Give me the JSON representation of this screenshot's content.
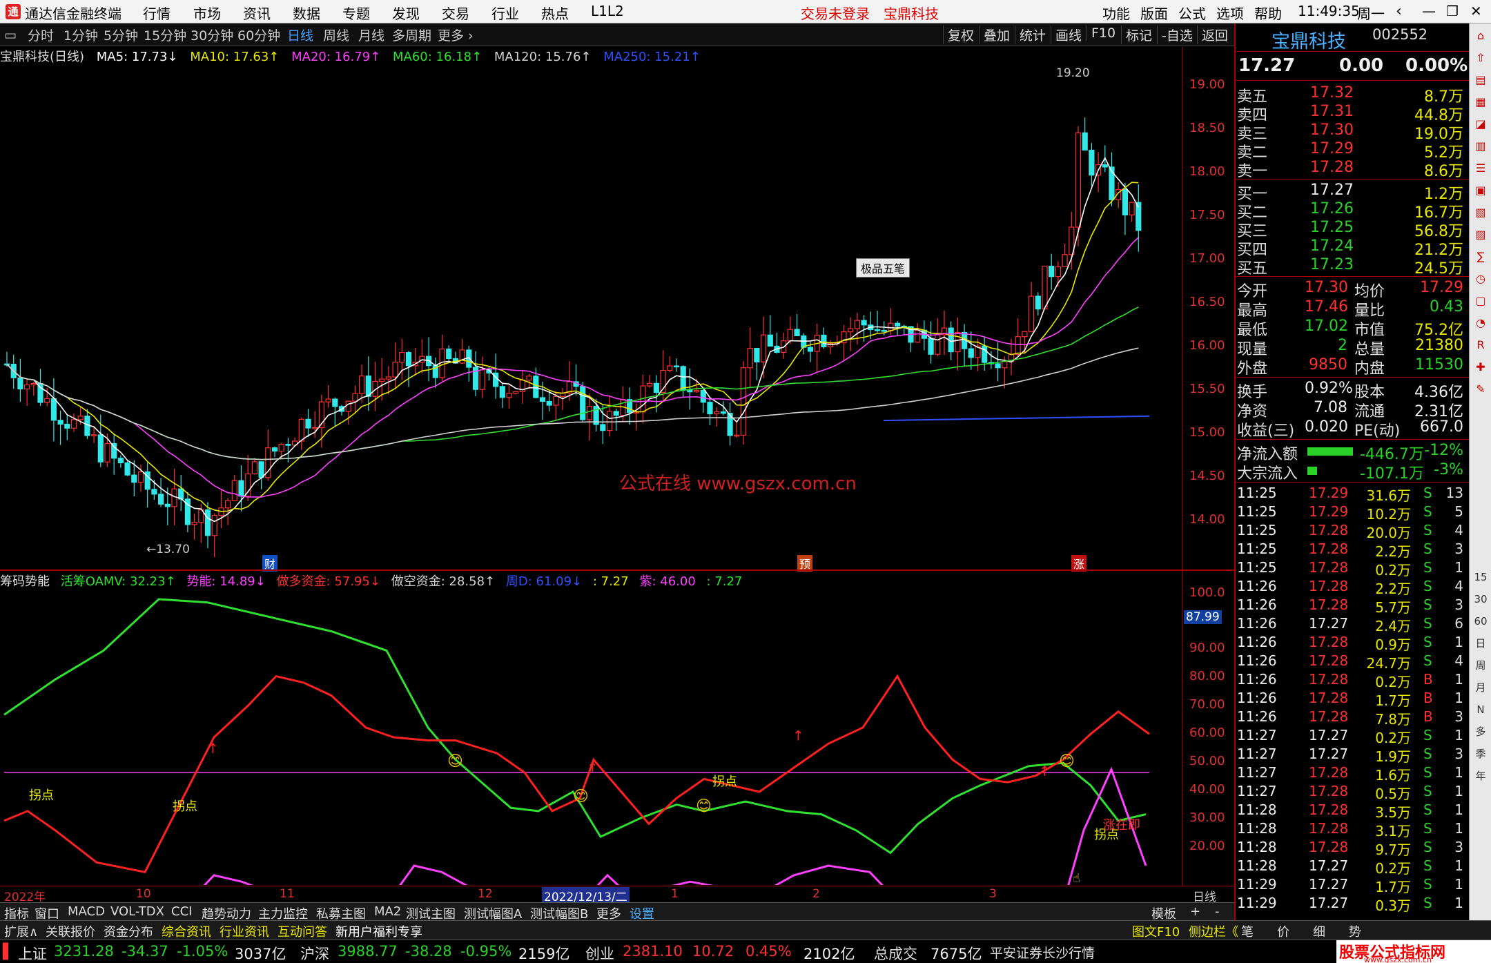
{
  "titlebar": {
    "app": "通达信金融终端",
    "menu": [
      "行情",
      "市场",
      "资讯",
      "数据",
      "专题",
      "发现",
      "交易",
      "行业",
      "热点",
      "L1L2"
    ],
    "trade_status": "交易未登录",
    "stock_name": "宝鼎科技",
    "right_menu": [
      "功能",
      "版面",
      "公式",
      "选项",
      "帮助"
    ],
    "time": "11:49:35",
    "weekday": "周一"
  },
  "periodbar": {
    "items": [
      "分时",
      "1分钟",
      "5分钟",
      "15分钟",
      "30分钟",
      "60分钟",
      "日线",
      "周线",
      "月线",
      "多周期",
      "更多 ›"
    ],
    "active": "日线",
    "right": [
      "复权",
      "叠加",
      "统计",
      "画线",
      "F10",
      "标记",
      "-自选",
      "返回"
    ]
  },
  "ma": {
    "name": "宝鼎科技(日线)",
    "items": [
      {
        "t": "MA5: 17.73↓",
        "c": "#ffffff"
      },
      {
        "t": "MA10: 17.63↑",
        "c": "#e8e800"
      },
      {
        "t": "MA20: 16.79↑",
        "c": "#ff40ff"
      },
      {
        "t": "MA60: 16.18↑",
        "c": "#30e030"
      },
      {
        "t": "MA120: 15.76↑",
        "c": "#d0d0d0"
      },
      {
        "t": "MA250: 15.21↑",
        "c": "#3050ff"
      }
    ]
  },
  "main_axis": {
    "ticks": [
      "19.00",
      "18.50",
      "18.00",
      "17.50",
      "17.00",
      "16.50",
      "16.00",
      "15.50",
      "15.00",
      "14.50",
      "14.00"
    ]
  },
  "main_chart": {
    "high_label": "19.20",
    "low_label": "←13.70",
    "watermark": "公式在线  www.gszx.com.cn",
    "toolbox": "极品五笔",
    "markers": [
      "财",
      "预",
      "涨"
    ]
  },
  "indicator": {
    "name": "筹码势能",
    "items": [
      {
        "t": "活筹OAMV: 32.23↑",
        "c": "#30e030"
      },
      {
        "t": "势能: 14.89↓",
        "c": "#ff40ff"
      },
      {
        "t": "做多资金: 57.95↓",
        "c": "#ff3030"
      },
      {
        "t": "做空资金: 28.58↑",
        "c": "#d0d0d0"
      },
      {
        "t": "周D: 61.09↓",
        "c": "#3050ff"
      },
      {
        "t": ": 7.27",
        "c": "#e8e800"
      },
      {
        "t": "紫: 46.00",
        "c": "#ff40ff"
      },
      {
        "t": ": 7.27",
        "c": "#30e030"
      }
    ],
    "current": "87.99",
    "labels": [
      "拐点",
      "拐点",
      "拐点",
      "拐点",
      "涨在即"
    ]
  },
  "sub_axis": {
    "ticks": [
      "100.0",
      "90.00",
      "80.00",
      "70.00",
      "60.00",
      "50.00",
      "40.00",
      "30.00",
      "20.00"
    ]
  },
  "xaxis": {
    "labels": [
      "2022年",
      "10",
      "11",
      "12",
      "2022/12/13/二",
      "1",
      "2",
      "3"
    ],
    "right": "日线"
  },
  "tabs1": {
    "items": [
      "指标",
      "窗口",
      "MACD",
      "VOL-TDX",
      "CCI",
      "趋势动力",
      "主力监控",
      "私募主图",
      "MA2",
      "测试主图",
      "测试幅图A",
      "测试幅图B",
      "更多",
      "设置"
    ],
    "right": [
      "模板",
      "+",
      "-"
    ]
  },
  "tabs2": {
    "items": [
      "扩展∧",
      "关联报价",
      "资金分布",
      "综合资讯",
      "行业资讯",
      "互动问答",
      "新用户福利专享"
    ],
    "right": [
      "图文F10",
      "侧边栏《",
      "笔",
      "价",
      "细",
      "势"
    ]
  },
  "status": {
    "sh_label": "上证",
    "sh": "3231.28",
    "sh_chg": "-34.37",
    "sh_pct": "-1.05%",
    "sh_amt": "3037亿",
    "hs_label": "沪深",
    "hs": "3988.77",
    "hs_chg": "-38.28",
    "hs_pct": "-0.95%",
    "hs_amt": "2159亿",
    "cy_label": "创业",
    "cy": "2381.10",
    "cy_chg": "10.72",
    "cy_pct": "0.45%",
    "cy_amt": "2102亿",
    "total_label": "总成交",
    "total": "7675亿",
    "broker": "平安证券长沙行情",
    "brand": "股票公式指标网",
    "brand_url": "www.gszx.com.cn"
  },
  "quote": {
    "name": "宝鼎科技",
    "code": "002552",
    "price": "17.27",
    "change": "0.00",
    "pct": "0.00%",
    "asks": [
      {
        "l": "卖五",
        "p": "17.32",
        "v": "8.7万"
      },
      {
        "l": "卖四",
        "p": "17.31",
        "v": "44.8万"
      },
      {
        "l": "卖三",
        "p": "17.30",
        "v": "19.0万"
      },
      {
        "l": "卖二",
        "p": "17.29",
        "v": "5.2万"
      },
      {
        "l": "卖一",
        "p": "17.28",
        "v": "8.6万"
      }
    ],
    "bids": [
      {
        "l": "买一",
        "p": "17.27",
        "v": "1.2万"
      },
      {
        "l": "买二",
        "p": "17.26",
        "v": "16.7万"
      },
      {
        "l": "买三",
        "p": "17.25",
        "v": "56.8万"
      },
      {
        "l": "买四",
        "p": "17.24",
        "v": "21.2万"
      },
      {
        "l": "买五",
        "p": "17.23",
        "v": "24.5万"
      }
    ],
    "stats": [
      [
        "今开",
        "17.30",
        "均价",
        "17.29"
      ],
      [
        "最高",
        "17.46",
        "量比",
        "0.43"
      ],
      [
        "最低",
        "17.02",
        "市值",
        "75.2亿"
      ],
      [
        "现量",
        "2",
        "总量",
        "21380"
      ],
      [
        "外盘",
        "9850",
        "内盘",
        "11530"
      ]
    ],
    "stats2": [
      [
        "换手",
        "0.92%",
        "股本",
        "4.36亿"
      ],
      [
        "净资",
        "7.08",
        "流通",
        "2.31亿"
      ],
      [
        "收益(三)",
        "0.020",
        "PE(动)",
        "667.0"
      ]
    ],
    "flow": [
      [
        "净流入额",
        "-446.7万",
        "-12%"
      ],
      [
        "大宗流入",
        "-107.1万",
        "-3%"
      ]
    ],
    "ticks": [
      [
        "11:25",
        "17.29",
        "31.6万",
        "S",
        "13"
      ],
      [
        "11:25",
        "17.29",
        "10.2万",
        "S",
        "5"
      ],
      [
        "11:25",
        "17.28",
        "20.0万",
        "S",
        "4"
      ],
      [
        "11:25",
        "17.28",
        "2.2万",
        "S",
        "3"
      ],
      [
        "11:25",
        "17.28",
        "0.2万",
        "S",
        "1"
      ],
      [
        "11:26",
        "17.28",
        "2.2万",
        "S",
        "4"
      ],
      [
        "11:26",
        "17.28",
        "5.7万",
        "S",
        "3"
      ],
      [
        "11:26",
        "17.27",
        "2.4万",
        "S",
        "6"
      ],
      [
        "11:26",
        "17.28",
        "0.9万",
        "S",
        "1"
      ],
      [
        "11:26",
        "17.28",
        "24.7万",
        "S",
        "4"
      ],
      [
        "11:26",
        "17.28",
        "0.2万",
        "B",
        "1"
      ],
      [
        "11:26",
        "17.28",
        "1.7万",
        "B",
        "1"
      ],
      [
        "11:26",
        "17.28",
        "7.8万",
        "B",
        "3"
      ],
      [
        "11:27",
        "17.27",
        "0.2万",
        "S",
        "1"
      ],
      [
        "11:27",
        "17.27",
        "1.9万",
        "S",
        "3"
      ],
      [
        "11:27",
        "17.28",
        "1.6万",
        "S",
        "1"
      ],
      [
        "11:27",
        "17.28",
        "0.5万",
        "S",
        "1"
      ],
      [
        "11:28",
        "17.28",
        "3.5万",
        "S",
        "1"
      ],
      [
        "11:28",
        "17.28",
        "3.1万",
        "S",
        "1"
      ],
      [
        "11:28",
        "17.28",
        "9.7万",
        "S",
        "3"
      ],
      [
        "11:28",
        "17.27",
        "0.2万",
        "S",
        "1"
      ],
      [
        "11:29",
        "17.27",
        "1.7万",
        "S",
        "1"
      ],
      [
        "11:29",
        "17.27",
        "0.3万",
        "S",
        "1"
      ]
    ]
  },
  "side_icons": [
    "15",
    "30",
    "60",
    "日",
    "周",
    "月",
    "N",
    "多",
    "季",
    "年"
  ]
}
